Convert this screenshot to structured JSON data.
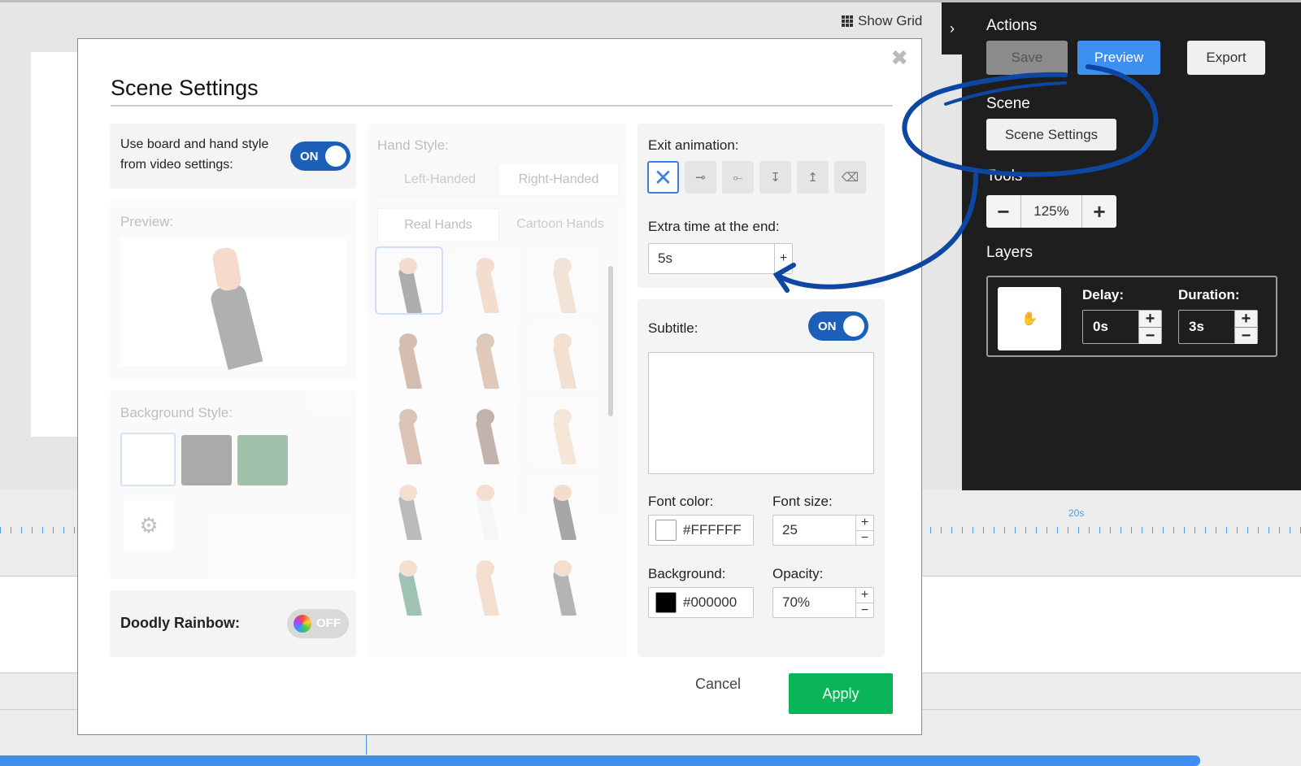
{
  "app": {
    "show_grid_label": "Show Grid",
    "ruler_label": "20s"
  },
  "panel": {
    "actions_heading": "Actions",
    "save_label": "Save",
    "preview_label": "Preview",
    "export_label": "Export",
    "scene_heading": "Scene",
    "scene_settings_label": "Scene Settings",
    "tools_heading": "Tools",
    "zoom_value": "125%",
    "layers_heading": "Layers",
    "delay_label": "Delay:",
    "delay_value": "0s",
    "duration_label": "Duration:",
    "duration_value": "3s"
  },
  "modal": {
    "title": "Scene Settings",
    "use_board_label_line1": "Use board and hand style",
    "use_board_label_line2": "from video settings:",
    "toggle_on": "ON",
    "toggle_off": "OFF",
    "preview_label": "Preview:",
    "background_style_label": "Background Style:",
    "doodly_rainbow_label": "Doodly Rainbow:",
    "hand_style_label": "Hand Style:",
    "left_handed": "Left-Handed",
    "right_handed": "Right-Handed",
    "real_hands": "Real Hands",
    "cartoon_hands": "Cartoon Hands",
    "exit_animation_label": "Exit animation:",
    "extra_time_label": "Extra time at the end:",
    "extra_time_value": "5s",
    "subtitle_label": "Subtitle:",
    "font_color_label": "Font color:",
    "font_color_value": "#FFFFFF",
    "font_size_label": "Font size:",
    "font_size_value": "25",
    "background_label": "Background:",
    "background_value": "#000000",
    "opacity_label": "Opacity:",
    "opacity_value": "70%",
    "cancel_label": "Cancel",
    "apply_label": "Apply"
  },
  "colors": {
    "accent_blue": "#3d8ff0",
    "toggle_blue": "#1b5fb8",
    "apply_green": "#0ab458",
    "annotation_blue": "#0d47a1"
  }
}
